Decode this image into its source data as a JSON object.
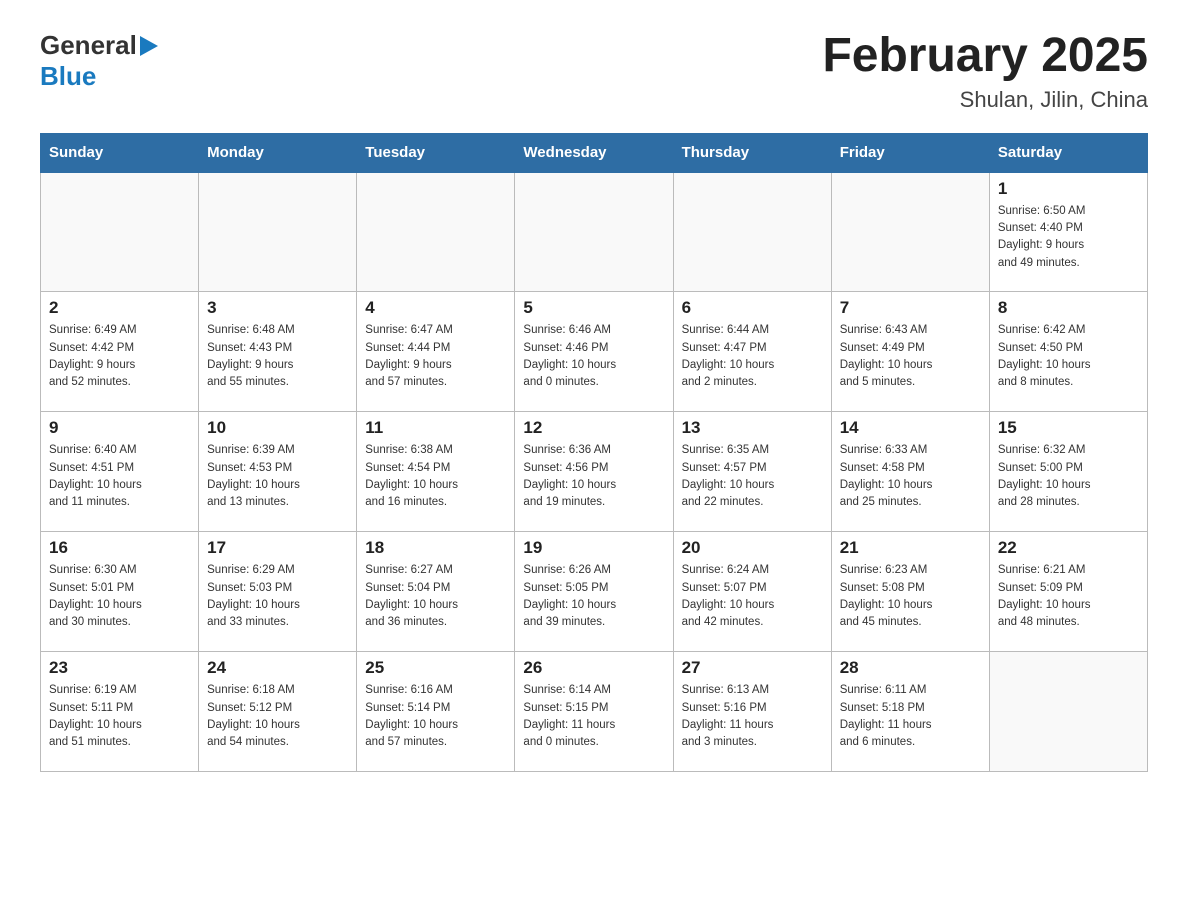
{
  "header": {
    "logo": {
      "general": "General",
      "blue": "Blue"
    },
    "title": "February 2025",
    "location": "Shulan, Jilin, China"
  },
  "weekdays": [
    "Sunday",
    "Monday",
    "Tuesday",
    "Wednesday",
    "Thursday",
    "Friday",
    "Saturday"
  ],
  "weeks": [
    [
      {
        "day": "",
        "info": ""
      },
      {
        "day": "",
        "info": ""
      },
      {
        "day": "",
        "info": ""
      },
      {
        "day": "",
        "info": ""
      },
      {
        "day": "",
        "info": ""
      },
      {
        "day": "",
        "info": ""
      },
      {
        "day": "1",
        "info": "Sunrise: 6:50 AM\nSunset: 4:40 PM\nDaylight: 9 hours\nand 49 minutes."
      }
    ],
    [
      {
        "day": "2",
        "info": "Sunrise: 6:49 AM\nSunset: 4:42 PM\nDaylight: 9 hours\nand 52 minutes."
      },
      {
        "day": "3",
        "info": "Sunrise: 6:48 AM\nSunset: 4:43 PM\nDaylight: 9 hours\nand 55 minutes."
      },
      {
        "day": "4",
        "info": "Sunrise: 6:47 AM\nSunset: 4:44 PM\nDaylight: 9 hours\nand 57 minutes."
      },
      {
        "day": "5",
        "info": "Sunrise: 6:46 AM\nSunset: 4:46 PM\nDaylight: 10 hours\nand 0 minutes."
      },
      {
        "day": "6",
        "info": "Sunrise: 6:44 AM\nSunset: 4:47 PM\nDaylight: 10 hours\nand 2 minutes."
      },
      {
        "day": "7",
        "info": "Sunrise: 6:43 AM\nSunset: 4:49 PM\nDaylight: 10 hours\nand 5 minutes."
      },
      {
        "day": "8",
        "info": "Sunrise: 6:42 AM\nSunset: 4:50 PM\nDaylight: 10 hours\nand 8 minutes."
      }
    ],
    [
      {
        "day": "9",
        "info": "Sunrise: 6:40 AM\nSunset: 4:51 PM\nDaylight: 10 hours\nand 11 minutes."
      },
      {
        "day": "10",
        "info": "Sunrise: 6:39 AM\nSunset: 4:53 PM\nDaylight: 10 hours\nand 13 minutes."
      },
      {
        "day": "11",
        "info": "Sunrise: 6:38 AM\nSunset: 4:54 PM\nDaylight: 10 hours\nand 16 minutes."
      },
      {
        "day": "12",
        "info": "Sunrise: 6:36 AM\nSunset: 4:56 PM\nDaylight: 10 hours\nand 19 minutes."
      },
      {
        "day": "13",
        "info": "Sunrise: 6:35 AM\nSunset: 4:57 PM\nDaylight: 10 hours\nand 22 minutes."
      },
      {
        "day": "14",
        "info": "Sunrise: 6:33 AM\nSunset: 4:58 PM\nDaylight: 10 hours\nand 25 minutes."
      },
      {
        "day": "15",
        "info": "Sunrise: 6:32 AM\nSunset: 5:00 PM\nDaylight: 10 hours\nand 28 minutes."
      }
    ],
    [
      {
        "day": "16",
        "info": "Sunrise: 6:30 AM\nSunset: 5:01 PM\nDaylight: 10 hours\nand 30 minutes."
      },
      {
        "day": "17",
        "info": "Sunrise: 6:29 AM\nSunset: 5:03 PM\nDaylight: 10 hours\nand 33 minutes."
      },
      {
        "day": "18",
        "info": "Sunrise: 6:27 AM\nSunset: 5:04 PM\nDaylight: 10 hours\nand 36 minutes."
      },
      {
        "day": "19",
        "info": "Sunrise: 6:26 AM\nSunset: 5:05 PM\nDaylight: 10 hours\nand 39 minutes."
      },
      {
        "day": "20",
        "info": "Sunrise: 6:24 AM\nSunset: 5:07 PM\nDaylight: 10 hours\nand 42 minutes."
      },
      {
        "day": "21",
        "info": "Sunrise: 6:23 AM\nSunset: 5:08 PM\nDaylight: 10 hours\nand 45 minutes."
      },
      {
        "day": "22",
        "info": "Sunrise: 6:21 AM\nSunset: 5:09 PM\nDaylight: 10 hours\nand 48 minutes."
      }
    ],
    [
      {
        "day": "23",
        "info": "Sunrise: 6:19 AM\nSunset: 5:11 PM\nDaylight: 10 hours\nand 51 minutes."
      },
      {
        "day": "24",
        "info": "Sunrise: 6:18 AM\nSunset: 5:12 PM\nDaylight: 10 hours\nand 54 minutes."
      },
      {
        "day": "25",
        "info": "Sunrise: 6:16 AM\nSunset: 5:14 PM\nDaylight: 10 hours\nand 57 minutes."
      },
      {
        "day": "26",
        "info": "Sunrise: 6:14 AM\nSunset: 5:15 PM\nDaylight: 11 hours\nand 0 minutes."
      },
      {
        "day": "27",
        "info": "Sunrise: 6:13 AM\nSunset: 5:16 PM\nDaylight: 11 hours\nand 3 minutes."
      },
      {
        "day": "28",
        "info": "Sunrise: 6:11 AM\nSunset: 5:18 PM\nDaylight: 11 hours\nand 6 minutes."
      },
      {
        "day": "",
        "info": ""
      }
    ]
  ]
}
